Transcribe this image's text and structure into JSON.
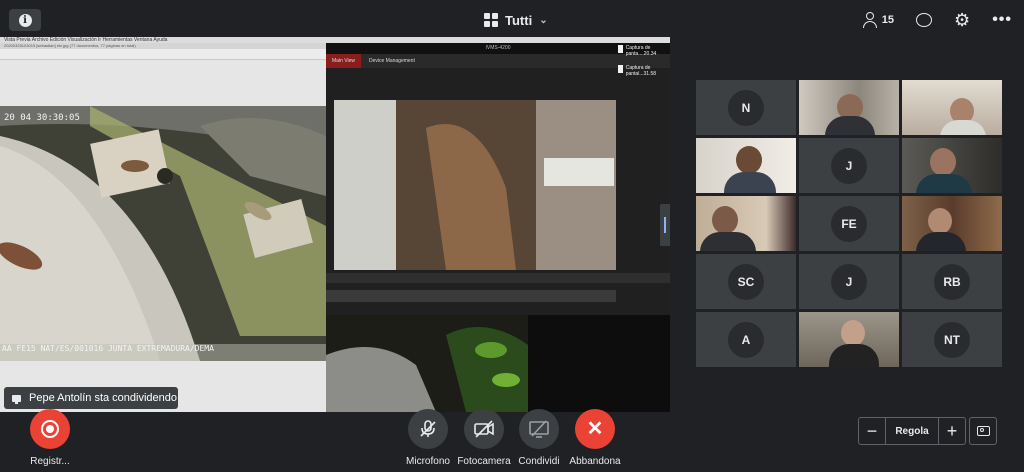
{
  "header": {
    "layout_label": "Tutti",
    "participants_count": "15"
  },
  "share": {
    "menubar_text": "Vista Previa   Archivo   Edición   Visualización   Ir   Herramientas   Ventana   Ayuda",
    "preview_title": "20200325103015 [sebastian] etc.jpg (77 documentos, 77 páginas en total)",
    "cam1_overlay_top": "20 04 30:30:05",
    "cam1_overlay_bottom": "AA FE15 NAT/ES/001016     JUNTA EXTREMADURA/DEMA",
    "nvr_title": "IVMS-4200",
    "nvr_tab_main": "Main View",
    "nvr_tab_device": "Device Management",
    "desktop_files": [
      "Captura de panta....20.34",
      "Captura de pantal...31.58"
    ]
  },
  "tiles": [
    {
      "initials": "N"
    },
    {
      "initials": ""
    },
    {
      "initials": ""
    },
    {
      "initials": ""
    },
    {
      "initials": "J"
    },
    {
      "initials": ""
    },
    {
      "initials": ""
    },
    {
      "initials": "FE"
    },
    {
      "initials": ""
    },
    {
      "initials": "SC"
    },
    {
      "initials": "J"
    },
    {
      "initials": "RB"
    },
    {
      "initials": "A"
    },
    {
      "initials": ""
    },
    {
      "initials": "NT"
    }
  ],
  "sharing_notice": "Pepe Antolín sta condividendo",
  "controls": {
    "record": "Registr...",
    "mic": "Microfono",
    "camera": "Fotocamera",
    "share": "Condividi",
    "leave": "Abbandona"
  },
  "zoom": {
    "label": "Regola",
    "minus": "−",
    "plus": "+"
  },
  "colors": {
    "leave_red": "#ea4335",
    "tile_bg": "#3c4043",
    "page_bg": "#202124"
  }
}
